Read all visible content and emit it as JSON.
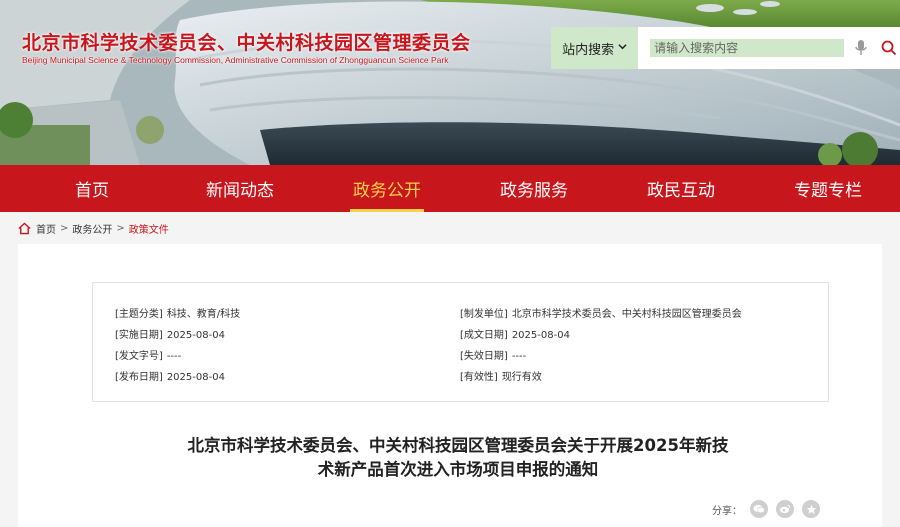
{
  "header": {
    "title": "北京市科学技术委员会、中关村科技园区管理委员会",
    "subtitle": "Beijing Municipal Science & Technology Commission, Administrative Commission of Zhongguancun Science Park",
    "search": {
      "scope_label": "站内搜索",
      "placeholder": "请输入搜索内容"
    }
  },
  "nav": {
    "items": [
      {
        "label": "首页"
      },
      {
        "label": "新闻动态"
      },
      {
        "label": "政务公开"
      },
      {
        "label": "政务服务"
      },
      {
        "label": "政民互动"
      },
      {
        "label": "专题专栏"
      }
    ],
    "active_index": 2
  },
  "breadcrumb": {
    "items": [
      "首页",
      "政务公开",
      "政策文件"
    ]
  },
  "meta": {
    "left": [
      {
        "key": "[主题分类]",
        "value": "科技、教育/科技"
      },
      {
        "key": "[实施日期]",
        "value": "2025-08-04"
      },
      {
        "key": "[发文字号]",
        "value": "----"
      },
      {
        "key": "[发布日期]",
        "value": "2025-08-04"
      }
    ],
    "right": [
      {
        "key": "[制发单位]",
        "value": "北京市科学技术委员会、中关村科技园区管理委员会"
      },
      {
        "key": "[成文日期]",
        "value": "2025-08-04"
      },
      {
        "key": "[失效日期]",
        "value": "----"
      },
      {
        "key": "[有效性]",
        "value": "现行有效"
      }
    ]
  },
  "document": {
    "title_line1": "北京市科学技术委员会、中关村科技园区管理委员会关于开展2025年新技",
    "title_line2": "术新产品首次进入市场项目申报的通知"
  },
  "share": {
    "label": "分享：",
    "icons": [
      "wechat-icon",
      "weibo-icon",
      "favorite-icon"
    ]
  },
  "colors": {
    "brand_red": "#c8161d",
    "active_nav": "#ffd24a",
    "search_bg": "#cfe8c9"
  }
}
